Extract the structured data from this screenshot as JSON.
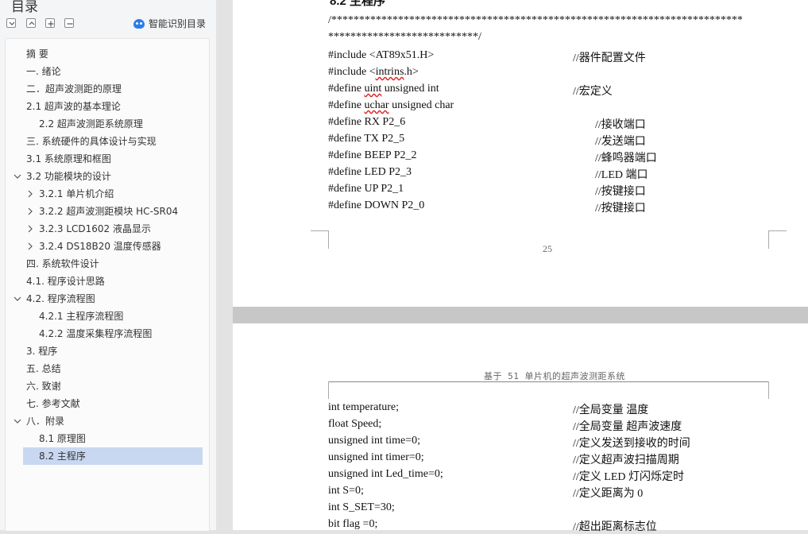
{
  "sidebar": {
    "title": "目录",
    "smart_toc_label": "智能识别目录",
    "items": [
      {
        "label": "摘 要",
        "level": 0
      },
      {
        "label": "一. 绪论",
        "level": 0
      },
      {
        "label": "二．超声波测距的原理",
        "level": 0
      },
      {
        "label": "2.1  超声波的基本理论",
        "level": 0
      },
      {
        "label": "2.2  超声波测距系统原理",
        "level": 1
      },
      {
        "label": "三. 系统硬件的具体设计与实现",
        "level": 0
      },
      {
        "label": "3.1  系统原理和框图",
        "level": 0
      },
      {
        "label": "3.2  功能模块的设计",
        "level": 0,
        "chevron": "down"
      },
      {
        "label": "3.2.1  单片机介绍",
        "level": 1,
        "chevron": "right"
      },
      {
        "label": "3.2.2    超声波测距模块 HC-SR04",
        "level": 1,
        "chevron": "right"
      },
      {
        "label": "3.2.3    LCD1602 液晶显示",
        "level": 1,
        "chevron": "right"
      },
      {
        "label": "3.2.4 DS18B20 温度传感器",
        "level": 1,
        "chevron": "right"
      },
      {
        "label": "四. 系统软件设计",
        "level": 0
      },
      {
        "label": "4.1. 程序设计思路",
        "level": 0
      },
      {
        "label": "4.2. 程序流程图",
        "level": 0,
        "chevron": "down"
      },
      {
        "label": "4.2.1 主程序流程图",
        "level": 1
      },
      {
        "label": "4.2.2  温度采集程序流程图",
        "level": 1
      },
      {
        "label": "3. 程序",
        "level": 0
      },
      {
        "label": "五. 总结",
        "level": 0
      },
      {
        "label": "六. 致谢",
        "level": 0
      },
      {
        "label": "七. 参考文献",
        "level": 0
      },
      {
        "label": "八．附录",
        "level": 0,
        "chevron": "down"
      },
      {
        "label": "8.1 原理图",
        "level": 1
      },
      {
        "label": "8.2 主程序",
        "level": 1,
        "selected": true
      }
    ]
  },
  "page1": {
    "heading": "8.2 主程序",
    "stars1": "/**************************************************************************",
    "stars2": "***************************/",
    "lines": [
      {
        "code": "#include <AT89x51.H>",
        "comment": "//器件配置文件"
      },
      {
        "code": "#include <intrins.h>",
        "comment": ""
      },
      {
        "code": "#define    uint unsigned int",
        "comment": "//宏定义"
      },
      {
        "code": "#define    uchar unsigned char",
        "comment": ""
      },
      {
        "code": "#define    RX      P2_6",
        "comment": "//接收端口"
      },
      {
        "code": "#define    TX      P2_5",
        "comment": "//发送端口"
      },
      {
        "code": "#define    BEEP P2_2",
        "comment": "//蜂鸣器端口"
      },
      {
        "code": "#define    LED    P2_3",
        "comment": "//LED 端口"
      },
      {
        "code": "#define    UP      P2_1",
        "comment": "//按键接口"
      },
      {
        "code": "#define    DOWN P2_0",
        "comment": "//按键接口"
      }
    ],
    "page_number": "25"
  },
  "page2": {
    "header": "基于 51 单片机的超声波测距系统",
    "lines": [
      {
        "code": "int temperature;",
        "comment": "//全局变量  温度"
      },
      {
        "code": "float Speed;",
        "comment": "//全局变量  超声波速度"
      },
      {
        "code": "unsigned int    time=0;",
        "comment": "//定义发送到接收的时间"
      },
      {
        "code": "unsigned int    timer=0;",
        "comment": "//定义超声波扫描周期"
      },
      {
        "code": "unsigned int    Led_time=0;",
        "comment": "//定义 LED 灯闪烁定时"
      },
      {
        "code": "int S=0;",
        "comment": "//定义距离为 0"
      },
      {
        "code": "int S_SET=30;",
        "comment": ""
      },
      {
        "code": "bit           flag =0;",
        "comment": "//超出距离标志位"
      }
    ]
  }
}
